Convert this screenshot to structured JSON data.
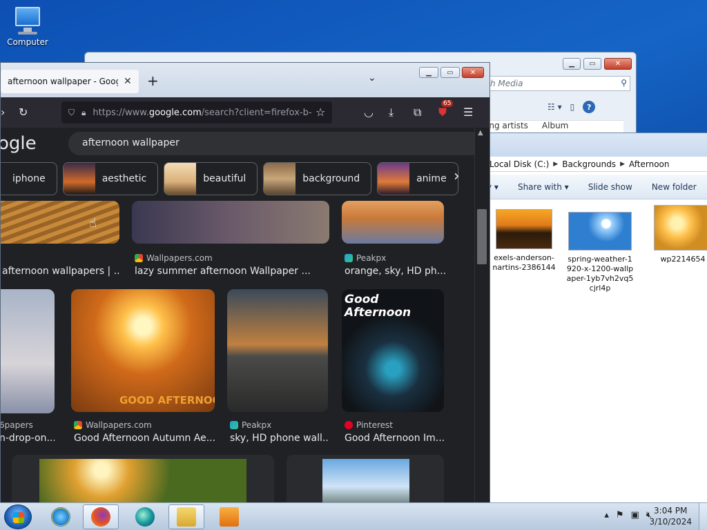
{
  "desktop": {
    "computer_label": "Computer"
  },
  "media_window": {
    "search_placeholder": "h Media",
    "column_1": "ing artists",
    "column_2": "Album"
  },
  "explorer": {
    "breadcrumb": [
      "Local Disk (C:)",
      "Backgrounds",
      "Afternoon"
    ],
    "commands": [
      "y",
      "Share with",
      "Slide show",
      "New folder"
    ],
    "files": [
      {
        "name": "exels-anderson-\nnartins-2386144"
      },
      {
        "name": "spring-weather-1\n920-x-1200-wallp\naper-1yb7vh2vq5\ncjrl4p"
      },
      {
        "name": "wp2214654"
      }
    ]
  },
  "firefox": {
    "tab_title": "afternoon wallpaper - Google Se",
    "url_prefix": "https://www.",
    "url_domain": "google.com",
    "url_rest": "/search?client=firefox-b-",
    "badge_count": "65",
    "google_logo": "ogle",
    "search_query": "afternoon wallpaper",
    "chips": [
      "iphone",
      "aesthetic",
      "beautiful",
      "background",
      "anime"
    ],
    "results": [
      {
        "source": "",
        "caption": "afternoon wallpapers | ..."
      },
      {
        "source": "Wallpapers.com",
        "caption": "lazy summer afternoon Wallpaper ..."
      },
      {
        "source": "Peakpx",
        "caption": "orange, sky, HD ph..."
      },
      {
        "source": "6papers",
        "caption": "n-drop-on..."
      },
      {
        "source": "Wallpapers.com",
        "caption": "Good Afternoon Autumn Ae..."
      },
      {
        "source": "Peakpx",
        "caption": "sky, HD phone wall..."
      },
      {
        "source": "Pinterest",
        "caption": "Good Afternoon Im..."
      }
    ],
    "overlay_autumn": "GOOD AFTERNOON",
    "overlay_apple": "Good\nAfternoon"
  },
  "taskbar": {
    "time": "3:04 PM",
    "date": "3/10/2024"
  }
}
